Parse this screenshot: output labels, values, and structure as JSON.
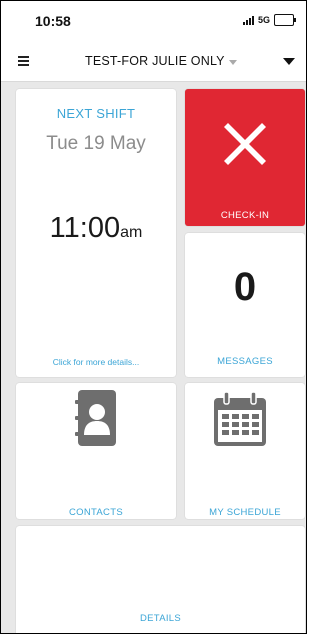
{
  "status_bar": {
    "time": "10:58",
    "network": "5G"
  },
  "app_bar": {
    "title": "TEST-FOR JULIE ONLY"
  },
  "tiles": {
    "next_shift": {
      "label": "NEXT SHIFT",
      "date": "Tue 19 May",
      "time": "11:00",
      "ampm": "am",
      "more_link": "Click for more details..."
    },
    "check_in": {
      "label": "CHECK-IN",
      "icon": "close-icon",
      "color": "#e02733"
    },
    "messages": {
      "count": "0",
      "label": "MESSAGES"
    },
    "contacts": {
      "label": "CONTACTS",
      "icon": "address-book-icon"
    },
    "schedule": {
      "label": "MY SCHEDULE",
      "icon": "calendar-icon"
    },
    "details": {
      "label": "DETAILS"
    }
  },
  "colors": {
    "accent": "#3ba5d6",
    "icon_gray": "#6e6e6e",
    "background": "#e8e8e8"
  }
}
